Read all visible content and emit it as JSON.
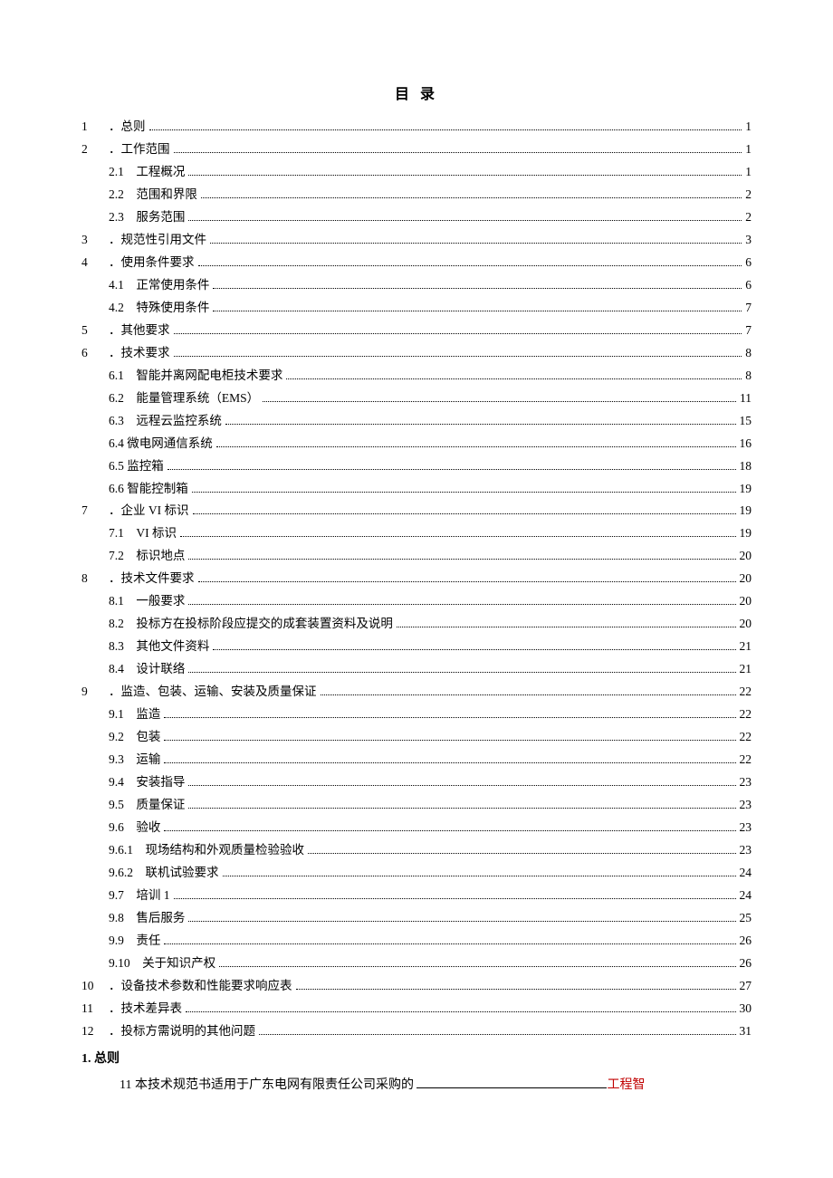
{
  "title": "目 录",
  "toc": [
    {
      "num": "1",
      "label": "．总则",
      "page": "1",
      "indent": 0
    },
    {
      "num": "2",
      "label": "．工作范围",
      "page": "1",
      "indent": 0
    },
    {
      "num": "",
      "label": "2.1　工程概况",
      "page": "1",
      "indent": 30
    },
    {
      "num": "",
      "label": "2.2　范围和界限",
      "page": "2",
      "indent": 30
    },
    {
      "num": "",
      "label": "2.3　服务范围",
      "page": "2",
      "indent": 30
    },
    {
      "num": "3",
      "label": "．规范性引用文件",
      "page": "3",
      "indent": 0
    },
    {
      "num": "4",
      "label": "．使用条件要求",
      "page": "6",
      "indent": 0
    },
    {
      "num": "",
      "label": "4.1　正常使用条件",
      "page": "6",
      "indent": 30
    },
    {
      "num": "",
      "label": "4.2　特殊使用条件",
      "page": "7",
      "indent": 30
    },
    {
      "num": "5",
      "label": "．其他要求",
      "page": "7",
      "indent": 0
    },
    {
      "num": "6",
      "label": "．技术要求",
      "page": "8",
      "indent": 0
    },
    {
      "num": "",
      "label": "6.1　智能并离网配电柜技术要求",
      "page": "8",
      "indent": 30
    },
    {
      "num": "",
      "label": "6.2　能量管理系统（EMS）",
      "page": "11",
      "indent": 30
    },
    {
      "num": "",
      "label": "6.3　远程云监控系统",
      "page": "15",
      "indent": 30
    },
    {
      "num": "",
      "label": "6.4 微电网通信系统",
      "page": "16",
      "indent": 30
    },
    {
      "num": "",
      "label": "6.5 监控箱",
      "page": "18",
      "indent": 30
    },
    {
      "num": "",
      "label": "6.6 智能控制箱",
      "page": "19",
      "indent": 30
    },
    {
      "num": "7",
      "label": "．企业 VI 标识",
      "page": "19",
      "indent": 0
    },
    {
      "num": "",
      "label": "7.1　VI 标识",
      "page": "19",
      "indent": 30
    },
    {
      "num": "",
      "label": "7.2　标识地点",
      "page": "20",
      "indent": 30
    },
    {
      "num": "8",
      "label": "．技术文件要求",
      "page": "20",
      "indent": 0
    },
    {
      "num": "",
      "label": "8.1　一般要求",
      "page": "20",
      "indent": 30
    },
    {
      "num": "",
      "label": "8.2　投标方在投标阶段应提交的成套装置资料及说明",
      "page": "20",
      "indent": 30
    },
    {
      "num": "",
      "label": "8.3　其他文件资料",
      "page": "21",
      "indent": 30
    },
    {
      "num": "",
      "label": "8.4　设计联络",
      "page": "21",
      "indent": 30
    },
    {
      "num": "9",
      "label": "．监造、包装、运输、安装及质量保证",
      "page": "22",
      "indent": 0
    },
    {
      "num": "",
      "label": "9.1　监造",
      "page": "22",
      "indent": 30
    },
    {
      "num": "",
      "label": "9.2　包装",
      "page": "22",
      "indent": 30
    },
    {
      "num": "",
      "label": "9.3　运输",
      "page": "22",
      "indent": 30
    },
    {
      "num": "",
      "label": "9.4　安装指导",
      "page": "23",
      "indent": 30
    },
    {
      "num": "",
      "label": "9.5　质量保证",
      "page": "23",
      "indent": 30
    },
    {
      "num": "",
      "label": "9.6　验收",
      "page": "23",
      "indent": 30
    },
    {
      "num": "",
      "label": "9.6.1　现场结构和外观质量检验验收",
      "page": "23",
      "indent": 30
    },
    {
      "num": "",
      "label": "9.6.2　联机试验要求",
      "page": "24",
      "indent": 30
    },
    {
      "num": "",
      "label": "9.7　培训 1",
      "page": "24",
      "indent": 30
    },
    {
      "num": "",
      "label": "9.8　售后服务",
      "page": "25",
      "indent": 30
    },
    {
      "num": "",
      "label": "9.9　责任",
      "page": "26",
      "indent": 30
    },
    {
      "num": "",
      "label": "9.10　关于知识产权",
      "page": "26",
      "indent": 30
    },
    {
      "num": "10",
      "label": "．设备技术参数和性能要求响应表",
      "page": "27",
      "indent": 0
    },
    {
      "num": "11",
      "label": "．技术差异表",
      "page": "30",
      "indent": 0
    },
    {
      "num": "12",
      "label": "．投标方需说明的其他问题",
      "page": "31",
      "indent": 0
    }
  ],
  "section_heading": "1. 总则",
  "body": {
    "prefix_indent": "　　　",
    "part1": "11 本技术规范书适用于广东电网有限责任公司采购的 ",
    "part2_red": "工程智"
  }
}
